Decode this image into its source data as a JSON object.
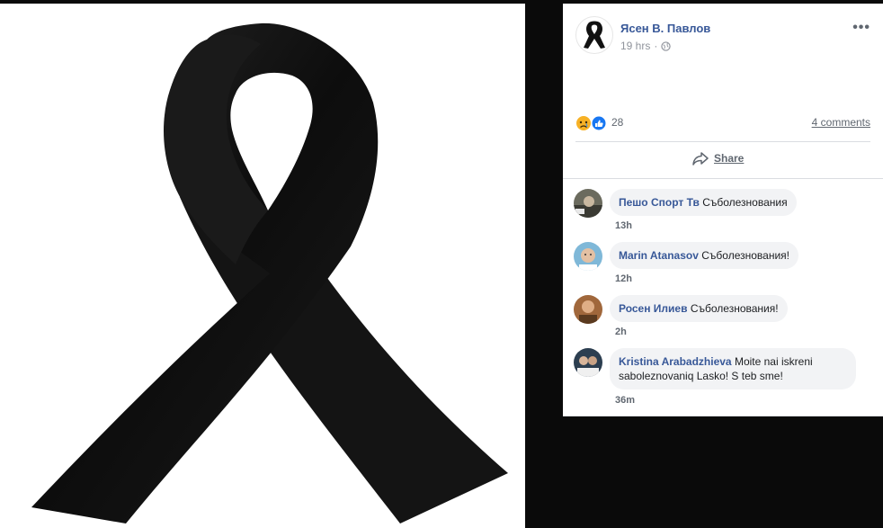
{
  "post": {
    "author_name": "Ясен В. Павлов",
    "timestamp": "19 hrs",
    "more_label": "•••",
    "reaction_count": "28",
    "comments_link": "4 comments",
    "share_label": "Share"
  },
  "comments": [
    {
      "name": "Пешо Спорт Тв",
      "text": "Съболезнования",
      "time": "13h"
    },
    {
      "name": "Marin Atanasov",
      "text": "Съболезнования!",
      "time": "12h"
    },
    {
      "name": "Росен Илиев",
      "text": "Съболезнования!",
      "time": "2h"
    },
    {
      "name": "Kristina Arabadzhieva",
      "text": "Moite nai iskreni saboleznovaniq Lasko! S teb sme!",
      "time": "36m"
    }
  ],
  "colors": {
    "link": "#385898",
    "meta": "#90949c",
    "bubble": "#f2f3f5",
    "ribbon": "#111111"
  },
  "icons": [
    "black-ribbon-icon",
    "globe-icon",
    "sad-reaction-icon",
    "like-reaction-icon",
    "share-arrow-icon"
  ]
}
